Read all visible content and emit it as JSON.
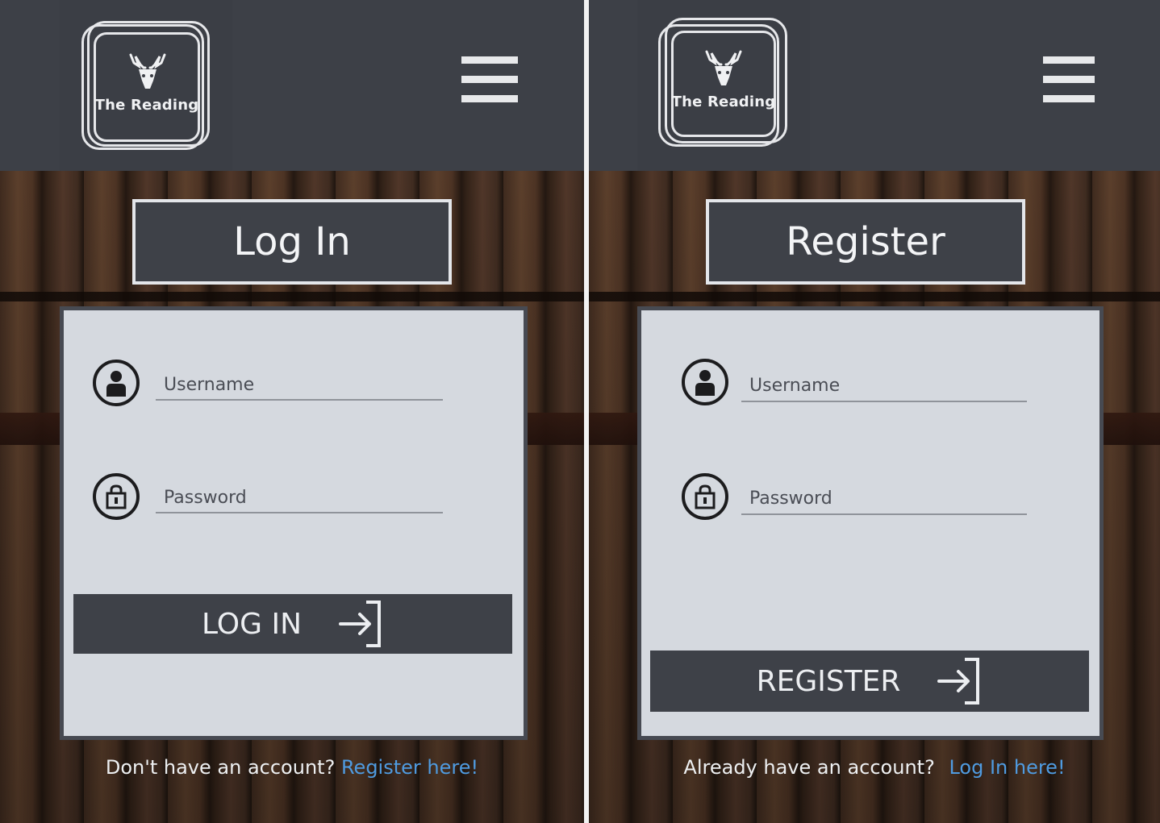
{
  "login": {
    "logo_text": "The Reading",
    "title": "Log In",
    "username_placeholder": "Username",
    "password_placeholder": "Password",
    "submit_label": "LOG IN",
    "footer_text": "Don't have an account?",
    "footer_link": "Register here!"
  },
  "register": {
    "logo_text": "The Reading",
    "title": "Register",
    "username_placeholder": "Username",
    "password_placeholder": "Password",
    "submit_label": "REGISTER",
    "footer_text": "Already have an account?",
    "footer_link": "Log In here!"
  },
  "icons": {
    "logo": "deer-icon",
    "menu": "hamburger-menu-icon",
    "username": "user-icon",
    "password": "lock-icon",
    "submit": "sign-in-arrow-icon"
  },
  "colors": {
    "header": "#3d4047",
    "card": "#d5d9df",
    "button": "#3e4148",
    "link": "#4f9be0"
  }
}
